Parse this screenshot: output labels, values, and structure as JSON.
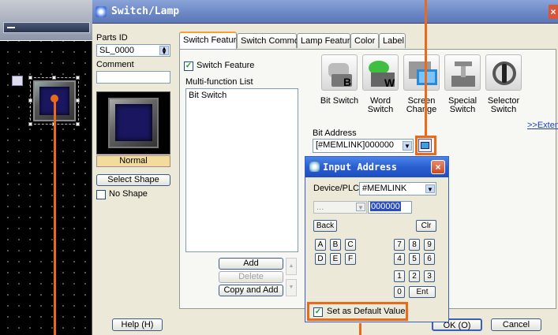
{
  "colors": {
    "accent_orange": "#e86a1a",
    "title_blue": "#6b86c4",
    "popup_blue": "#2a5ed0",
    "button_face": "#1a1760"
  },
  "dialog": {
    "title": "Switch/Lamp",
    "parts_id_label": "Parts ID",
    "parts_id_value": "SL_0000",
    "comment_label": "Comment",
    "comment_value": "",
    "state_label": "Normal",
    "select_shape": "Select Shape",
    "no_shape": "No Shape",
    "help": "Help (H)",
    "ok": "OK (O)",
    "cancel": "Cancel"
  },
  "tabs": [
    "Switch Feature",
    "Switch Common",
    "Lamp Feature",
    "Color",
    "Label"
  ],
  "switch_feature": {
    "enable_label": "Switch Feature",
    "list_label": "Multi-function List",
    "list_items": [
      "Bit Switch"
    ],
    "add": "Add",
    "delete": "Delete",
    "copy_add": "Copy and Add",
    "switches": [
      {
        "line1": "Bit Switch",
        "line2": "",
        "icon": "bit-switch-icon"
      },
      {
        "line1": "Word",
        "line2": "Switch",
        "icon": "word-switch-icon"
      },
      {
        "line1": "Screen",
        "line2": "Change",
        "icon": "screen-change-icon"
      },
      {
        "line1": "Special",
        "line2": "Switch",
        "icon": "special-switch-icon"
      },
      {
        "line1": "Selector",
        "line2": "Switch",
        "icon": "selector-switch-icon"
      }
    ],
    "extended": ">>Extended",
    "bit_address_label": "Bit Address",
    "bit_address_value": "[#MEMLINK]000000"
  },
  "input_address": {
    "title": "Input Address",
    "device_label": "Device/PLC",
    "device_value": "#MEMLINK",
    "address_value": "000000",
    "back": "Back",
    "clr": "Clr",
    "hex_keys": [
      "A",
      "B",
      "C",
      "D",
      "E",
      "F"
    ],
    "num_keys": [
      "7",
      "8",
      "9",
      "4",
      "5",
      "6",
      "1",
      "2",
      "3",
      "0"
    ],
    "ent": "Ent",
    "default_label": "Set as Default Value"
  }
}
